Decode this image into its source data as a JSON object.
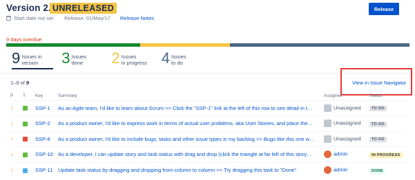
{
  "header": {
    "title": "Version 2.0",
    "lozenge": "UNRELEASED",
    "start_date": "Start date not set",
    "release": "Release: 01/May/17",
    "notes_link": "Release Notes",
    "release_button": "Release"
  },
  "progress": {
    "overdue": "9 days overdue",
    "done_fraction": 0.333,
    "in_progress_fraction": 0.222,
    "todo_fraction": 0.445,
    "colors": {
      "done": "#14892c",
      "in_progress": "#f6c342",
      "todo": "#4a6785"
    }
  },
  "counts": [
    {
      "num": "9",
      "label_1": "Issues in",
      "label_2": "version",
      "color": "#172b4d"
    },
    {
      "num": "3",
      "label_1": "Issues",
      "label_2": "done",
      "color": "#14892c"
    },
    {
      "num": "2",
      "label_1": "Issues",
      "label_2": "in progress",
      "color": "#f6c342"
    },
    {
      "num": "4",
      "label_1": "Issues",
      "label_2": "to do",
      "color": "#4a6785"
    }
  ],
  "issues": {
    "range_prefix": "1–9 of",
    "range_total": "9",
    "navigator_link": "View in Issue Navigator",
    "columns": {
      "p": "P",
      "t": "T",
      "key": "Key",
      "summary": "Summary",
      "assignee": "Assignee",
      "status": "Status"
    },
    "rows": [
      {
        "key": "SSP-1",
        "type": "story",
        "summary": "As an Agile team, I'd like to learn about Scrum >> Click the \"SSP-1\" link at the left of this row to see detail in t…",
        "assignee": "Unassigned",
        "status": "TO DO"
      },
      {
        "key": "SSP-2",
        "type": "story",
        "summary": "As a product owner, I'd like to express work in terms of actual user problems, aka User Stories, and place the…",
        "assignee": "Unassigned",
        "status": "TO DO"
      },
      {
        "key": "SSP-8",
        "type": "bug",
        "summary": "As a product owner, I'd like to include bugs, tasks and other issue types in my backlog >> Bugs like this one w…",
        "assignee": "Unassigned",
        "status": "TO DO"
      },
      {
        "key": "SSP-10",
        "type": "story",
        "summary": "As a developer, I can update story and task status with drag and drop (click the triangle at far left of this story…",
        "assignee": "admin",
        "status": "IN PROGRESS"
      },
      {
        "key": "SSP-11",
        "type": "task",
        "summary": "Update task status by dragging and dropping from column to column >> Try dragging this task to \"Done\"",
        "assignee": "admin",
        "status": "DONE"
      }
    ]
  },
  "colors": {
    "story": "#63ba3c",
    "bug": "#e5493a",
    "task": "#4bade8",
    "todo_bg": "#dfe1e6",
    "todo_fg": "#42526e",
    "inprog_bg": "#fff0b3",
    "inprog_fg": "#172b4d",
    "done_bg": "#e3fcef",
    "done_fg": "#006644"
  }
}
